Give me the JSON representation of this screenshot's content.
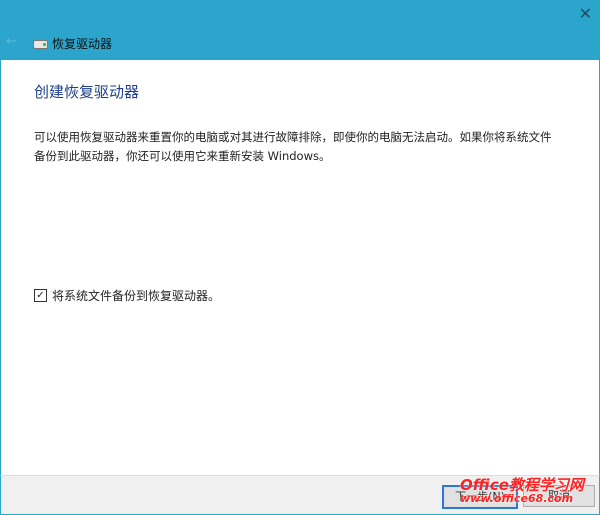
{
  "window": {
    "title": "恢复驱动器",
    "close_icon": "close-icon",
    "back_icon": "back-arrow-icon",
    "drive_icon": "drive-icon",
    "header_color": "#2ba5cc"
  },
  "main": {
    "heading": "创建恢复驱动器",
    "description": "可以使用恢复驱动器来重置你的电脑或对其进行故障排除，即使你的电脑无法启动。如果你将系统文件备份到此驱动器，你还可以使用它来重新安装 Windows。",
    "checkbox": {
      "label": "将系统文件备份到恢复驱动器。",
      "checked": true
    }
  },
  "footer": {
    "next_label": "下一步(N)",
    "cancel_label": "取消"
  },
  "watermark": {
    "line1": "Office教程学习网",
    "line2": "www.office68.com"
  }
}
